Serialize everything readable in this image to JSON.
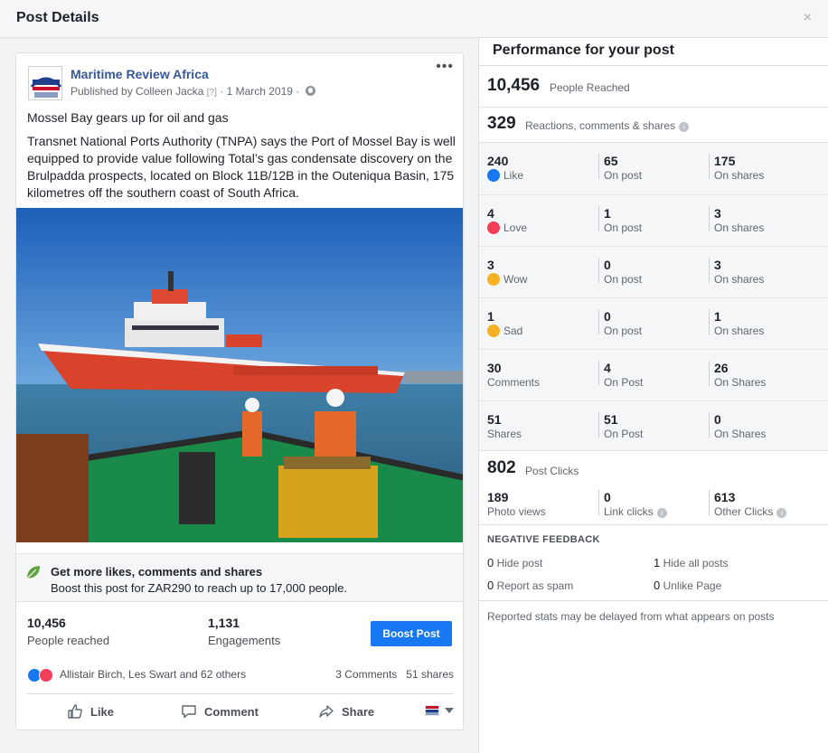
{
  "dialog": {
    "title": "Post Details",
    "close": "×"
  },
  "post": {
    "page_name": "Maritime Review Africa",
    "published_by": "Published by Colleen Jacka",
    "help_marker": "[?]",
    "date": "· 1 March 2019 ·",
    "menu": "•••",
    "title": "Mossel Bay gears up for oil and gas",
    "body": "Transnet National Ports Authority (TNPA) says the Port of Mossel Bay is well equipped to provide value following Total’s gas condensate discovery on the Brulpadda prospects, located on Block 11B/12B in the Outeniqua Basin, 175 kilometres off the southern coast of South Africa."
  },
  "promo": {
    "title": "Get more likes, comments and shares",
    "text": "Boost this post for ZAR290 to reach up to 17,000 people."
  },
  "post_stats": {
    "reached_value": "10,456",
    "reached_label": "People reached",
    "engagements_value": "1,131",
    "engagements_label": "Engagements",
    "boost_label": "Boost Post"
  },
  "social": {
    "reactors": "Allistair Birch, Les Swart and 62 others",
    "comments": "3 Comments",
    "shares": "51 shares"
  },
  "actions": {
    "like": "Like",
    "comment": "Comment",
    "share": "Share"
  },
  "performance": {
    "title": "Performance for your post",
    "reached_value": "10,456",
    "reached_label": "People Reached",
    "engage_value": "329",
    "engage_label": "Reactions, comments & shares",
    "rows": [
      {
        "total": "240",
        "label": "Like",
        "post": "65",
        "post_label": "On post",
        "shares": "175",
        "shares_label": "On shares"
      },
      {
        "total": "4",
        "label": "Love",
        "post": "1",
        "post_label": "On post",
        "shares": "3",
        "shares_label": "On shares"
      },
      {
        "total": "3",
        "label": "Wow",
        "post": "0",
        "post_label": "On post",
        "shares": "3",
        "shares_label": "On shares"
      },
      {
        "total": "1",
        "label": "Sad",
        "post": "0",
        "post_label": "On post",
        "shares": "1",
        "shares_label": "On shares"
      },
      {
        "total": "30",
        "label": "Comments",
        "post": "4",
        "post_label": "On Post",
        "shares": "26",
        "shares_label": "On Shares"
      },
      {
        "total": "51",
        "label": "Shares",
        "post": "51",
        "post_label": "On Post",
        "shares": "0",
        "shares_label": "On Shares"
      }
    ],
    "clicks_value": "802",
    "clicks_label": "Post Clicks",
    "clicks": {
      "photo_value": "189",
      "photo_label": "Photo views",
      "link_value": "0",
      "link_label": "Link clicks",
      "other_value": "613",
      "other_label": "Other Clicks"
    },
    "negative": {
      "title": "NEGATIVE FEEDBACK",
      "hide_post_value": "0",
      "hide_post_label": "Hide post",
      "hide_all_value": "1",
      "hide_all_label": "Hide all posts",
      "spam_value": "0",
      "spam_label": "Report as spam",
      "unlike_value": "0",
      "unlike_label": "Unlike Page"
    },
    "note": "Reported stats may be delayed from what appears on posts"
  },
  "colors": {
    "facebook_blue": "#1877f2",
    "link_blue": "#365899",
    "like_blue": "#1877f2",
    "love_red": "#f33e58",
    "leaf_green": "#5fa142"
  },
  "icons": [
    "leaf-icon",
    "globe-icon",
    "like-icon",
    "love-icon",
    "wow-icon",
    "sad-icon",
    "thumb-icon",
    "comment-icon",
    "share-icon",
    "info-icon",
    "flag-icon"
  ]
}
